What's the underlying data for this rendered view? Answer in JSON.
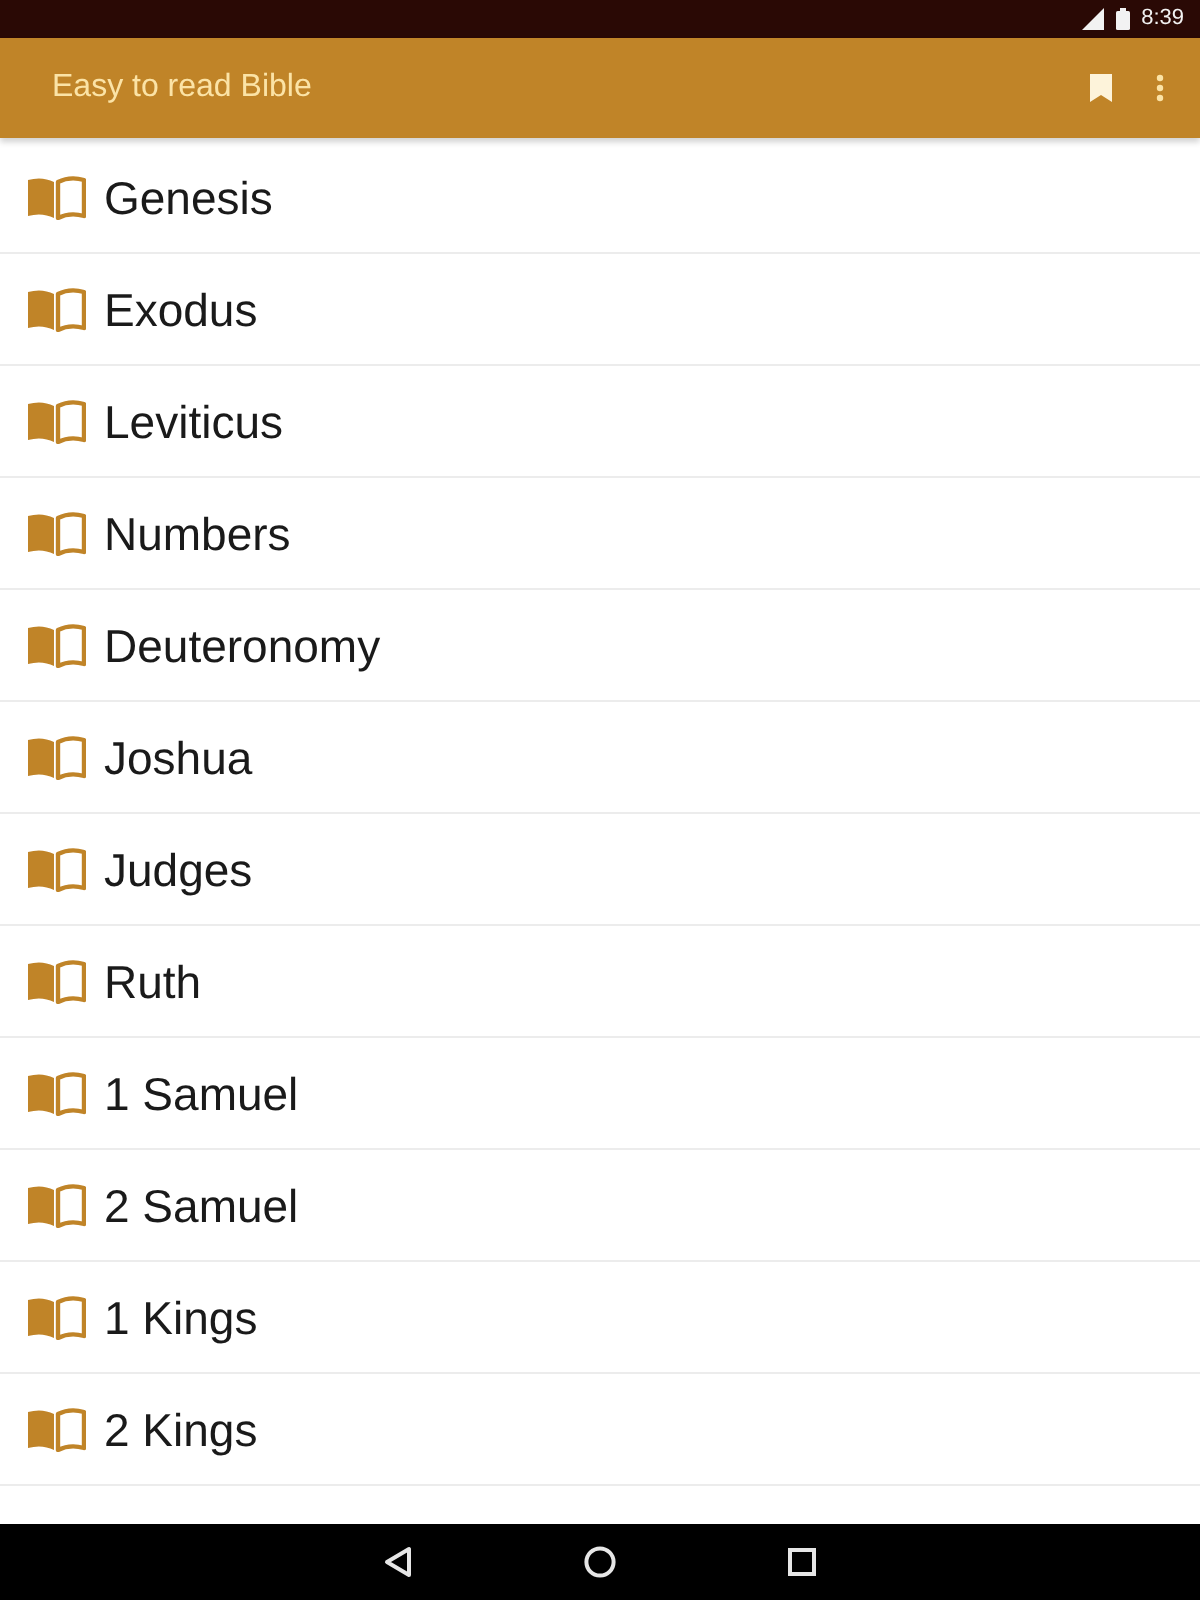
{
  "status_bar": {
    "time": "8:39"
  },
  "toolbar": {
    "title": "Easy to read Bible"
  },
  "books": [
    {
      "name": "Genesis"
    },
    {
      "name": "Exodus"
    },
    {
      "name": "Leviticus"
    },
    {
      "name": "Numbers"
    },
    {
      "name": "Deuteronomy"
    },
    {
      "name": "Joshua"
    },
    {
      "name": "Judges"
    },
    {
      "name": "Ruth"
    },
    {
      "name": "1 Samuel"
    },
    {
      "name": "2 Samuel"
    },
    {
      "name": "1 Kings"
    },
    {
      "name": "2 Kings"
    }
  ]
}
